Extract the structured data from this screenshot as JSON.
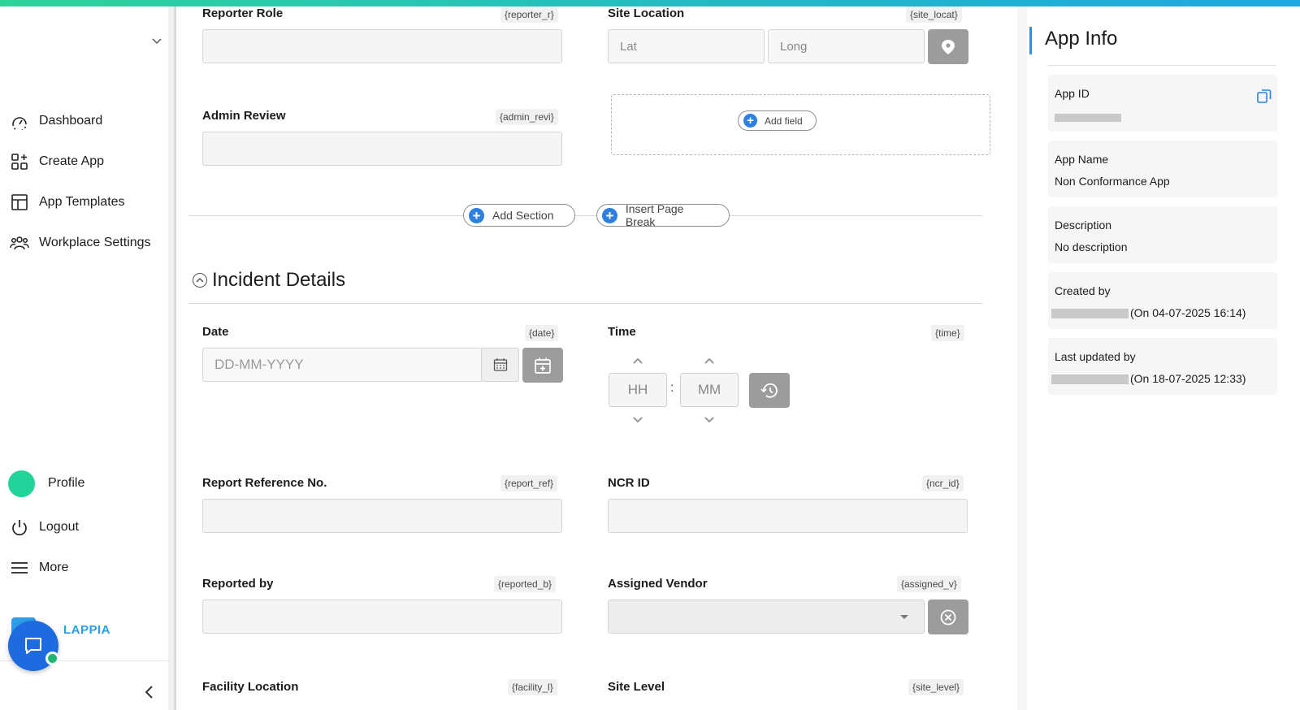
{
  "sidebar": {
    "nav": [
      {
        "label": "Dashboard",
        "icon": "dashboard-icon"
      },
      {
        "label": "Create App",
        "icon": "create-app-icon"
      },
      {
        "label": "App Templates",
        "icon": "templates-icon"
      },
      {
        "label": "Workplace Settings",
        "icon": "workplace-settings-icon"
      }
    ],
    "bottom": [
      {
        "label": "Profile",
        "icon": "avatar"
      },
      {
        "label": "Logout",
        "icon": "power-icon"
      },
      {
        "label": "More",
        "icon": "menu-icon"
      }
    ],
    "brand": "LAPPIA"
  },
  "form": {
    "reporter_role": {
      "label": "Reporter Role",
      "tag": "{reporter_r}"
    },
    "site_location": {
      "label": "Site Location",
      "tag": "{site_locat}",
      "lat_placeholder": "Lat",
      "long_placeholder": "Long"
    },
    "admin_review": {
      "label": "Admin Review",
      "tag": "{admin_revi}"
    },
    "add_field": "Add field",
    "add_section": "Add Section",
    "insert_page_break": "Insert Page Break",
    "section_title": "Incident Details",
    "date": {
      "label": "Date",
      "tag": "{date}",
      "placeholder": "DD-MM-YYYY"
    },
    "time": {
      "label": "Time",
      "tag": "{time}",
      "hh": "HH",
      "mm": "MM",
      "sep": ":"
    },
    "report_ref": {
      "label": "Report Reference No.",
      "tag": "{report_ref}"
    },
    "ncr_id": {
      "label": "NCR ID",
      "tag": "{ncr_id}"
    },
    "reported_by": {
      "label": "Reported by",
      "tag": "{reported_b}"
    },
    "assigned_vendor": {
      "label": "Assigned Vendor",
      "tag": "{assigned_v}"
    },
    "facility_location": {
      "label": "Facility Location",
      "tag": "{facility_l}"
    },
    "site_level": {
      "label": "Site Level",
      "tag": "{site_level}"
    }
  },
  "app_info": {
    "title": "App Info",
    "app_id_label": "App ID",
    "app_name_label": "App Name",
    "app_name": "Non Conformance App",
    "description_label": "Description",
    "description": "No description",
    "created_by_label": "Created by",
    "created_on": "(On 04-07-2025 16:14)",
    "last_updated_label": "Last updated by",
    "updated_on": "(On 18-07-2025 12:33)"
  },
  "colors": {
    "accent": "#2d7fe0",
    "brand_green": "#22d39a",
    "grey_button": "#9c9c9c"
  }
}
